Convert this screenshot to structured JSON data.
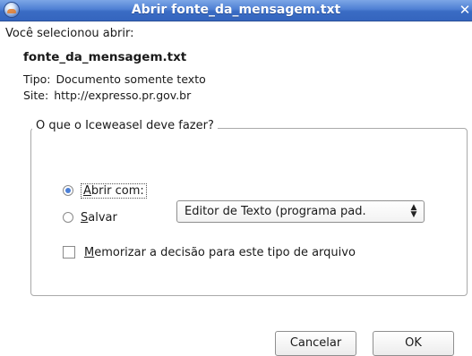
{
  "window": {
    "title": "Abrir fonte_da_mensagem.txt",
    "close_glyph": "✕"
  },
  "dialog": {
    "intro": "Você selecionou abrir:",
    "filename": "fonte_da_mensagem.txt",
    "type_label": "Tipo:",
    "type_value": "Documento somente texto",
    "site_label": "Site:",
    "site_value": "http://expresso.pr.gov.br"
  },
  "group": {
    "title": "O que o Iceweasel deve fazer?",
    "open_with": {
      "mnemonic": "A",
      "rest": "brir com:",
      "checked": true
    },
    "app_select": {
      "selected": "Editor de Texto (programa pad."
    },
    "save": {
      "mnemonic": "S",
      "rest": "alvar",
      "checked": false
    },
    "remember": {
      "mnemonic": "M",
      "rest": "emorizar a decisão para este tipo de arquivo",
      "checked": false
    }
  },
  "buttons": {
    "cancel": "Cancelar",
    "ok": "OK"
  },
  "colors": {
    "titlebar": "#4f80d4",
    "radio_dot": "#4b7fd6"
  },
  "icons": {
    "app": "iceweasel-app-icon",
    "close": "close-icon",
    "select_arrows": "updown-arrows-icon"
  }
}
